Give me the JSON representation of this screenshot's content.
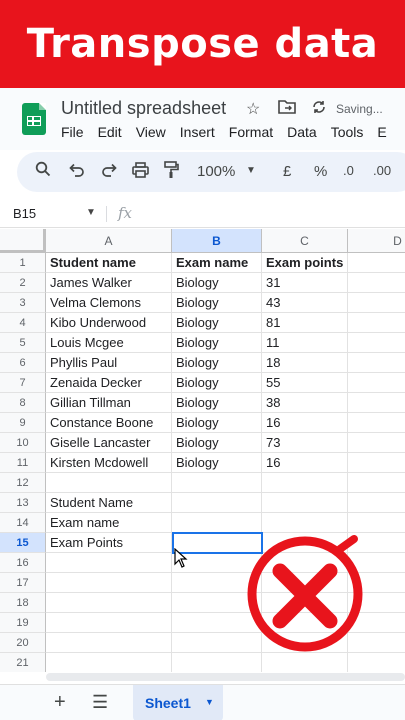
{
  "banner": {
    "title": "Transpose data"
  },
  "app": {
    "doc_title": "Untitled spreadsheet",
    "saving_status": "Saving...",
    "menu": [
      "File",
      "Edit",
      "View",
      "Insert",
      "Format",
      "Data",
      "Tools",
      "E"
    ]
  },
  "toolbar": {
    "zoom": "100%",
    "currency": "£",
    "percent": "%",
    "dec_decrease": ".0",
    "dec_increase": ".00"
  },
  "formula_bar": {
    "name_box": "B15",
    "fx": "fx"
  },
  "grid": {
    "columns": [
      "A",
      "B",
      "C",
      "D"
    ],
    "selected_column": "B",
    "selected_row": 15,
    "rows": [
      [
        "Student name",
        "Exam name",
        "Exam points"
      ],
      [
        "James Walker",
        "Biology",
        "31"
      ],
      [
        "Velma Clemons",
        "Biology",
        "43"
      ],
      [
        "Kibo Underwood",
        "Biology",
        "81"
      ],
      [
        "Louis Mcgee",
        "Biology",
        "11"
      ],
      [
        "Phyllis Paul",
        "Biology",
        "18"
      ],
      [
        "Zenaida Decker",
        "Biology",
        "55"
      ],
      [
        "Gillian Tillman",
        "Biology",
        "38"
      ],
      [
        "Constance Boone",
        "Biology",
        "16"
      ],
      [
        "Giselle Lancaster",
        "Biology",
        "73"
      ],
      [
        "Kirsten Mcdowell",
        "Biology",
        "16"
      ],
      [
        "",
        "",
        ""
      ],
      [
        "Student Name",
        "",
        ""
      ],
      [
        "Exam name",
        "",
        ""
      ],
      [
        "Exam Points",
        "",
        ""
      ],
      [
        "",
        "",
        ""
      ],
      [
        "",
        "",
        ""
      ],
      [
        "",
        "",
        ""
      ],
      [
        "",
        "",
        ""
      ],
      [
        "",
        "",
        ""
      ],
      [
        "",
        "",
        ""
      ]
    ]
  },
  "sheet_tabs": {
    "active": "Sheet1"
  },
  "colors": {
    "banner": "#e8141c",
    "selection": "#1a73e8",
    "x_mark": "#e8141c"
  }
}
